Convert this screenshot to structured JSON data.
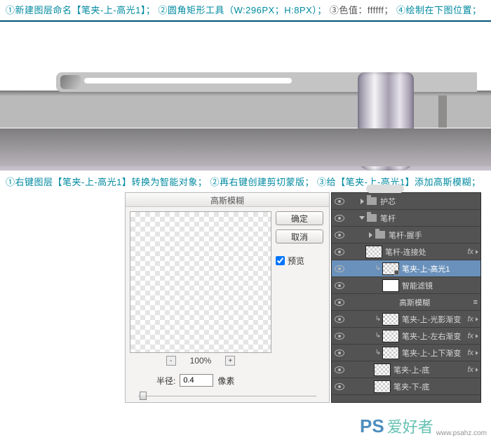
{
  "instr1": {
    "p1": "①新建图层命名【笔夹-上-高光1】；",
    "p2": "②圆角矩形工具（W:296PX；H:8PX）；",
    "p3": "③色值：ffffff；",
    "p4": "④绘制在下图位置；"
  },
  "instr2": {
    "p1": "①右键图层【笔夹-上-高光1】转换为智能对象；",
    "p2": "②再右键创建剪切蒙版；",
    "p3": "③给【笔夹-上-高光1】添加高斯模糊；"
  },
  "dialog": {
    "title": "高斯模糊",
    "ok": "确定",
    "cancel": "取消",
    "preview": "预览",
    "zoom": "100%",
    "radius_label": "半径:",
    "radius_value": "0.4",
    "radius_unit": "像素"
  },
  "layers": [
    {
      "vis": true,
      "kind": "folder-closed",
      "name": "护芯",
      "depth": 1
    },
    {
      "vis": true,
      "kind": "folder-open",
      "name": "笔杆",
      "depth": 1
    },
    {
      "vis": true,
      "kind": "folder-closed",
      "name": "笔杆-握手",
      "depth": 2
    },
    {
      "vis": true,
      "kind": "layer",
      "ck": true,
      "name": "笔杆-连接处",
      "fx": true,
      "depth": 2
    },
    {
      "vis": true,
      "kind": "smart",
      "ck": true,
      "clip": true,
      "name": "笔夹-上-高光1",
      "sel": true,
      "depth": 3
    },
    {
      "vis": true,
      "kind": "label",
      "name": "智能滤镜",
      "depth": 4,
      "mask": true
    },
    {
      "vis": true,
      "kind": "fx",
      "name": "高斯模糊",
      "depth": 4,
      "fxa": true
    },
    {
      "vis": true,
      "kind": "layer",
      "ck": true,
      "clip": true,
      "name": "笔夹-上-光影渐变",
      "fx": true,
      "depth": 3
    },
    {
      "vis": true,
      "kind": "layer",
      "ck": true,
      "clip": true,
      "name": "笔夹-上-左右渐变",
      "fx": true,
      "depth": 3
    },
    {
      "vis": true,
      "kind": "layer",
      "ck": true,
      "clip": true,
      "name": "笔夹-上-上下渐变",
      "fx": true,
      "depth": 3
    },
    {
      "vis": true,
      "kind": "layer",
      "ck": true,
      "name": "笔夹-上-底",
      "fx": true,
      "depth": 3
    },
    {
      "vis": true,
      "kind": "layer",
      "ck": true,
      "name": "笔夹-下-底",
      "depth": 3
    }
  ],
  "wm": {
    "ps": "PS",
    "cn": "爱好者",
    "en": "www.psahz.com"
  }
}
